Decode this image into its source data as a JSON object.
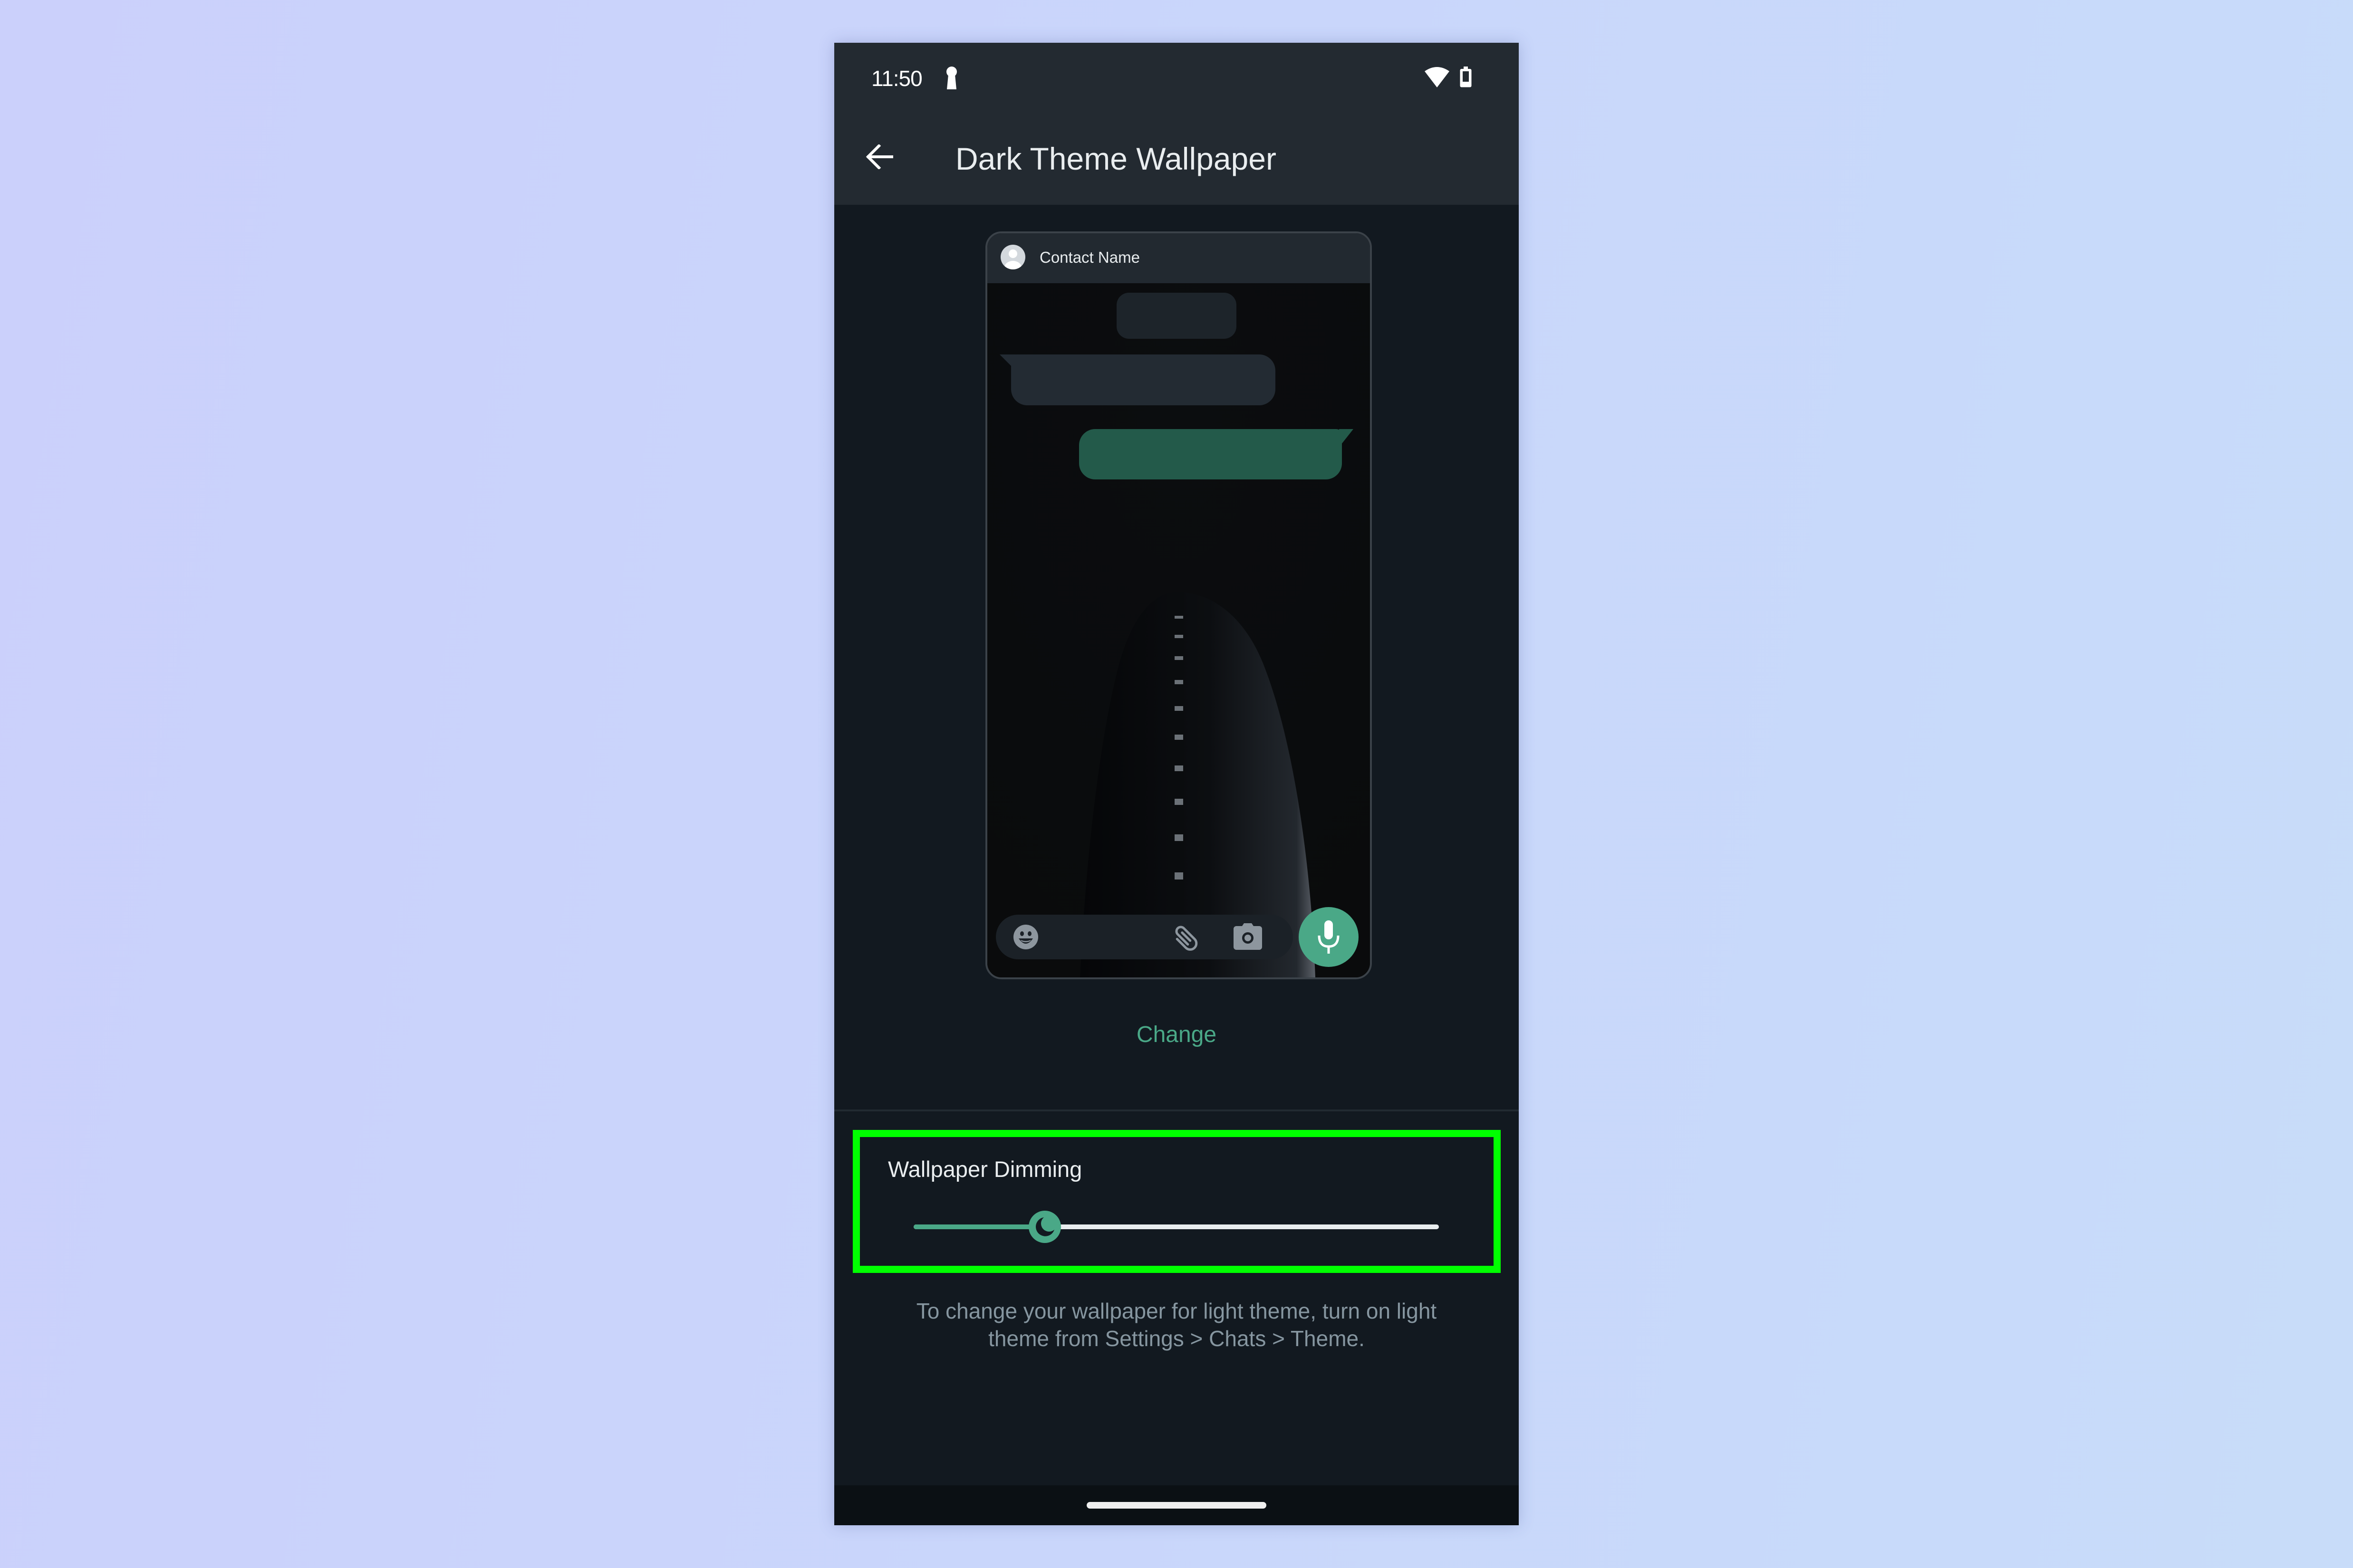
{
  "status_bar": {
    "time": "11:50",
    "icons": [
      "keyhole-icon",
      "wifi-icon",
      "battery-icon"
    ]
  },
  "app_bar": {
    "back_icon": "arrow-left-icon",
    "title": "Dark Theme Wallpaper"
  },
  "preview": {
    "contact_name": "Contact Name",
    "avatar_icon": "person-icon",
    "input_icons": [
      "emoji-icon",
      "paperclip-icon",
      "camera-icon"
    ],
    "mic_icon": "microphone-icon"
  },
  "change_label": "Change",
  "dimming": {
    "label": "Wallpaper Dimming",
    "value": 0.25,
    "thumb_icon": "moon-icon"
  },
  "hint": "To change your wallpaper for light theme, turn on light theme from Settings > Chats > Theme.",
  "colors": {
    "accent": "#4aa887",
    "outgoing_bubble": "#235a4a",
    "highlight": "#00ff00",
    "background": "#121920",
    "app_bar": "#232a31"
  }
}
